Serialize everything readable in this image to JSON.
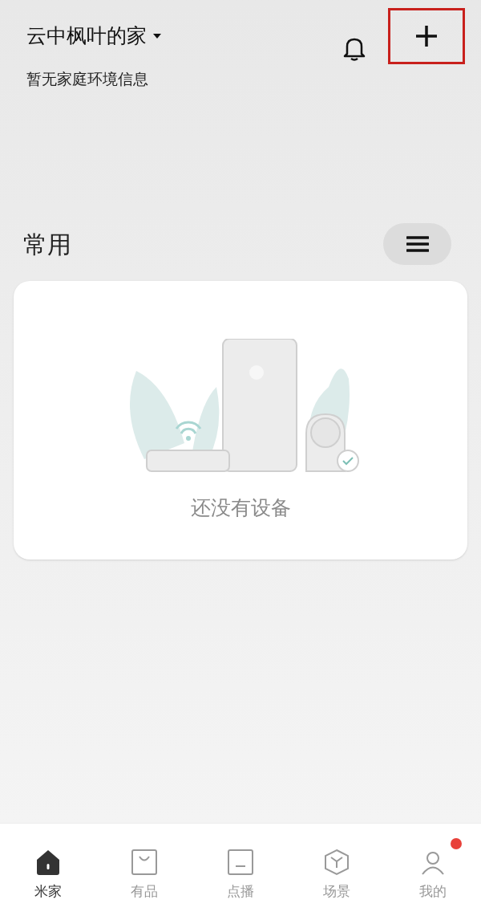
{
  "header": {
    "home_name": "云中枫叶的家",
    "subtitle": "暂无家庭环境信息",
    "add_highlighted": true
  },
  "section": {
    "title": "常用"
  },
  "empty_card": {
    "message": "还没有设备"
  },
  "nav": [
    {
      "kind": "home",
      "label": "米家",
      "selected": true,
      "dot": false
    },
    {
      "kind": "shop",
      "label": "有品",
      "selected": false,
      "dot": false
    },
    {
      "kind": "play",
      "label": "点播",
      "selected": false,
      "dot": false
    },
    {
      "kind": "scene",
      "label": "场景",
      "selected": false,
      "dot": false
    },
    {
      "kind": "profile",
      "label": "我的",
      "selected": false,
      "dot": true
    }
  ]
}
